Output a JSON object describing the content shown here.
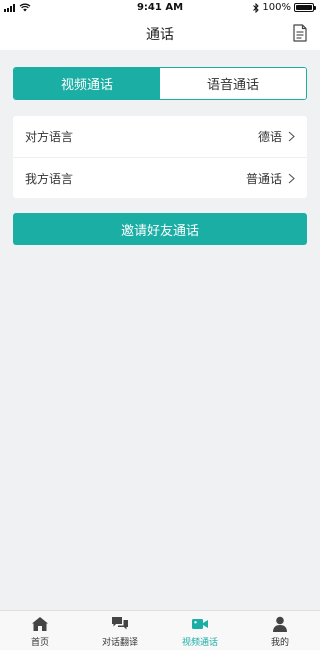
{
  "status_bar": {
    "time": "9:41 AM",
    "battery_text": "100%"
  },
  "header": {
    "title": "通话"
  },
  "tabs": [
    {
      "label": "视频通话",
      "active": true
    },
    {
      "label": "语音通话",
      "active": false
    }
  ],
  "settings": [
    {
      "label": "对方语言",
      "value": "德语"
    },
    {
      "label": "我方语言",
      "value": "普通话"
    }
  ],
  "invite_button": {
    "label": "邀请好友通话"
  },
  "tab_bar": [
    {
      "label": "首页",
      "icon": "home-icon",
      "active": false
    },
    {
      "label": "对话翻译",
      "icon": "chat-icon",
      "active": false
    },
    {
      "label": "视频通话",
      "icon": "video-camera-icon",
      "active": true
    },
    {
      "label": "我的",
      "icon": "person-icon",
      "active": false
    }
  ],
  "colors": {
    "accent": "#1aaea5",
    "background": "#f0f1f3",
    "tab_icon_inactive": "#444444"
  }
}
